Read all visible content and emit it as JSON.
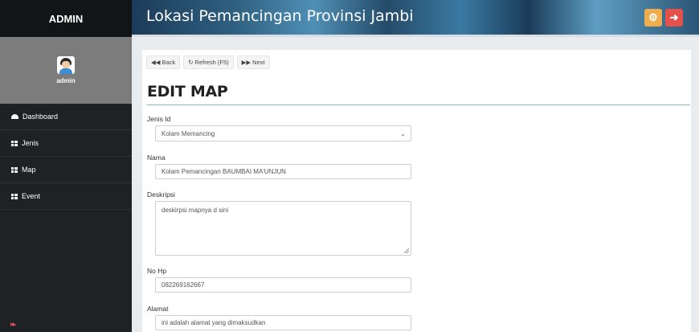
{
  "sidebar": {
    "brand": "ADMIN",
    "username": "admin",
    "items": [
      {
        "label": "Dashboard",
        "icon": "dashboard-icon"
      },
      {
        "label": "Jenis",
        "icon": "table-icon"
      },
      {
        "label": "Map",
        "icon": "table-icon"
      },
      {
        "label": "Event",
        "icon": "table-icon"
      }
    ]
  },
  "header": {
    "title": "Lokasi Pemancingan Provinsi Jambi",
    "settings_icon": "gear-icon",
    "logout_icon": "arrow-right-icon",
    "colors": {
      "settings": "#f0ad4e",
      "logout": "#e4514a"
    }
  },
  "toolbar": {
    "back": "Back",
    "refresh": "Refresh (F5)",
    "next": "Next"
  },
  "page": {
    "title": "EDIT MAP"
  },
  "form": {
    "jenis": {
      "label": "Jenis Id",
      "value": "Kolam Memancing"
    },
    "nama": {
      "label": "Nama",
      "value": "Kolam Pemancingan BAUMBAI MA'UNJUN"
    },
    "deskripsi": {
      "label": "Deskripsi",
      "value": "deskirpsi mapnya d sini"
    },
    "nohp": {
      "label": "No Hp",
      "value": "082269162667"
    },
    "alamat": {
      "label": "Alamat",
      "value": "ini adalah alamat yang dimaksudkan"
    }
  }
}
